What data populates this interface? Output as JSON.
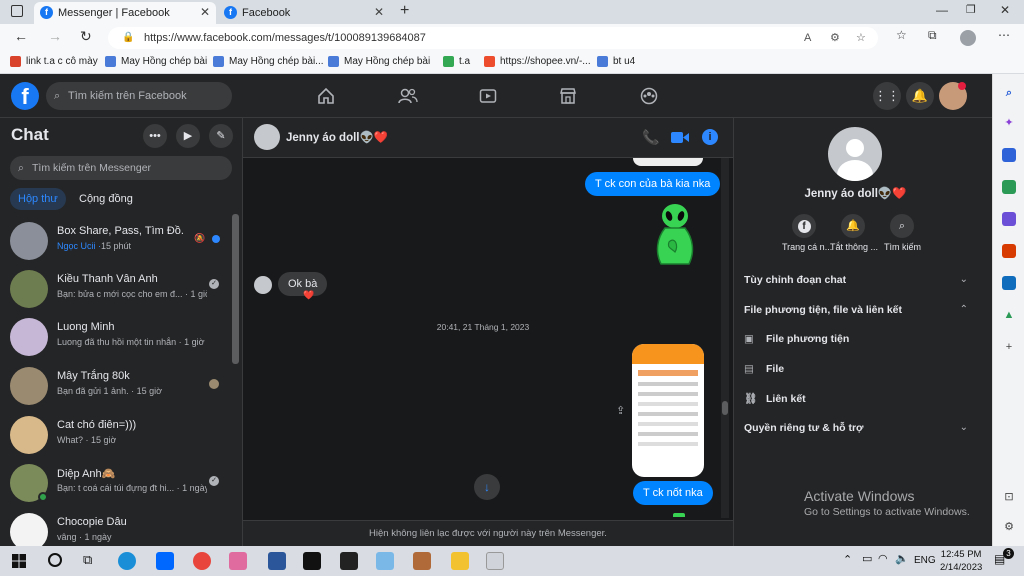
{
  "browser": {
    "tabs": [
      {
        "title": "Messenger | Facebook",
        "active": true
      },
      {
        "title": "Facebook",
        "active": false
      }
    ],
    "url": "https://www.facebook.com/messages/t/100089139684087",
    "bookmarks": [
      {
        "label": "link t.a c cô mày",
        "color": "#d9432c"
      },
      {
        "label": "May Hồng chép bài",
        "color": "#4a7bd8"
      },
      {
        "label": "May Hồng chép bài...",
        "color": "#4a7bd8"
      },
      {
        "label": "May Hồng chép bài",
        "color": "#4a7bd8"
      },
      {
        "label": "t.a",
        "color": "#34a853"
      },
      {
        "label": "https://shopee.vn/-...",
        "color": "#ee4d2d"
      },
      {
        "label": "bt u4",
        "color": "#4a7bd8"
      }
    ]
  },
  "facebook": {
    "search_placeholder": "Tìm kiếm trên Facebook"
  },
  "chat_list": {
    "title": "Chat",
    "search_placeholder": "Tìm kiếm trên Messenger",
    "tabs": [
      {
        "label": "Hộp thư",
        "active": true
      },
      {
        "label": "Cộng đồng",
        "active": false
      }
    ],
    "conversations": [
      {
        "name": "Box Share, Pass, Tìm Đồ.",
        "preview": "Ngọc Ucii ·",
        "meta": "15 phút",
        "unread": true,
        "avatar": "#8a8f99"
      },
      {
        "name": "Kiều Thanh Vân Anh",
        "preview": "Bạn: bửa c mới cọc cho em đ... · 1 giờ",
        "meta": "",
        "unread": false,
        "avatar": "#6e7d4f"
      },
      {
        "name": "Luong Minh",
        "preview": "Luong đã thu hồi một tin nhắn · 1 giờ",
        "meta": "",
        "unread": false,
        "avatar": "#c6b7d6"
      },
      {
        "name": "Mây Trắng 80k",
        "preview": "Bạn đã gửi 1 ảnh. · 15 giờ",
        "meta": "",
        "unread": false,
        "avatar": "#9a8a70"
      },
      {
        "name": "Cat chó điên=)))",
        "preview": "What? · 15 giờ",
        "meta": "",
        "unread": false,
        "avatar": "#d8b98a"
      },
      {
        "name": "Diệp Anh🙈",
        "preview": "Bạn: t coá cái túi đựng đt hi... · 1 ngày",
        "meta": "",
        "unread": false,
        "avatar": "#7b8c5a"
      },
      {
        "name": "Chocopie Dâu",
        "preview": "vâng · 1 ngày",
        "meta": "",
        "unread": false,
        "avatar": "#f3f3f3"
      }
    ]
  },
  "conversation": {
    "contact_name": "Jenny áo doll👽❤️",
    "messages": {
      "out1": "T ck con của bà kia nka",
      "in1": "Ok bà",
      "in1_reaction": "❤️",
      "timestamp": "20:41, 21 Tháng 1, 2023",
      "out2": "T ck nốt nka"
    },
    "footer_note": "Hiện không liên lạc được với người này trên Messenger."
  },
  "info_panel": {
    "name": "Jenny áo doll👽❤️",
    "actions": [
      {
        "label": "Trang cá n...",
        "icon": "facebook-icon"
      },
      {
        "label": "Tắt thông ...",
        "icon": "bell-icon"
      },
      {
        "label": "Tìm kiếm",
        "icon": "search-icon"
      }
    ],
    "sections": {
      "customize": "Tùy chỉnh đoạn chat",
      "media": "File phương tiện, file và liên kết",
      "media_files": "File phương tiện",
      "files": "File",
      "links": "Liên kết",
      "privacy": "Quyền riêng tư & hỗ trợ"
    }
  },
  "windows": {
    "watermark_title": "Activate Windows",
    "watermark_sub": "Go to Settings to activate Windows.",
    "lang": "ENG",
    "time": "12:45 PM",
    "date": "2/14/2023",
    "notif_count": "3"
  }
}
